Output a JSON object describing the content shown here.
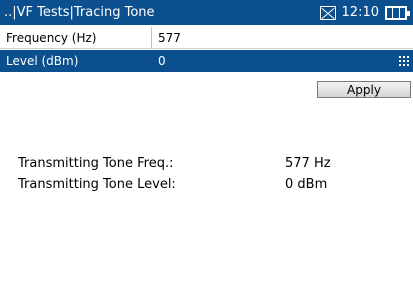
{
  "header": {
    "title": "..|VF Tests|Tracing Tone",
    "time": "12:10"
  },
  "fields": [
    {
      "label": "Frequency (Hz)",
      "value": "577"
    },
    {
      "label": "Level (dBm)",
      "value": "0"
    }
  ],
  "apply_label": "Apply",
  "info": [
    {
      "label": "Transmitting Tone Freq.:",
      "value": "577 Hz"
    },
    {
      "label": "Transmitting Tone Level:",
      "value": "0 dBm"
    }
  ],
  "icons": {
    "status_icon": "close-box-icon",
    "battery": "battery-icon",
    "keypad": "keypad-icon"
  },
  "colors": {
    "accent": "#0b4f8f"
  }
}
